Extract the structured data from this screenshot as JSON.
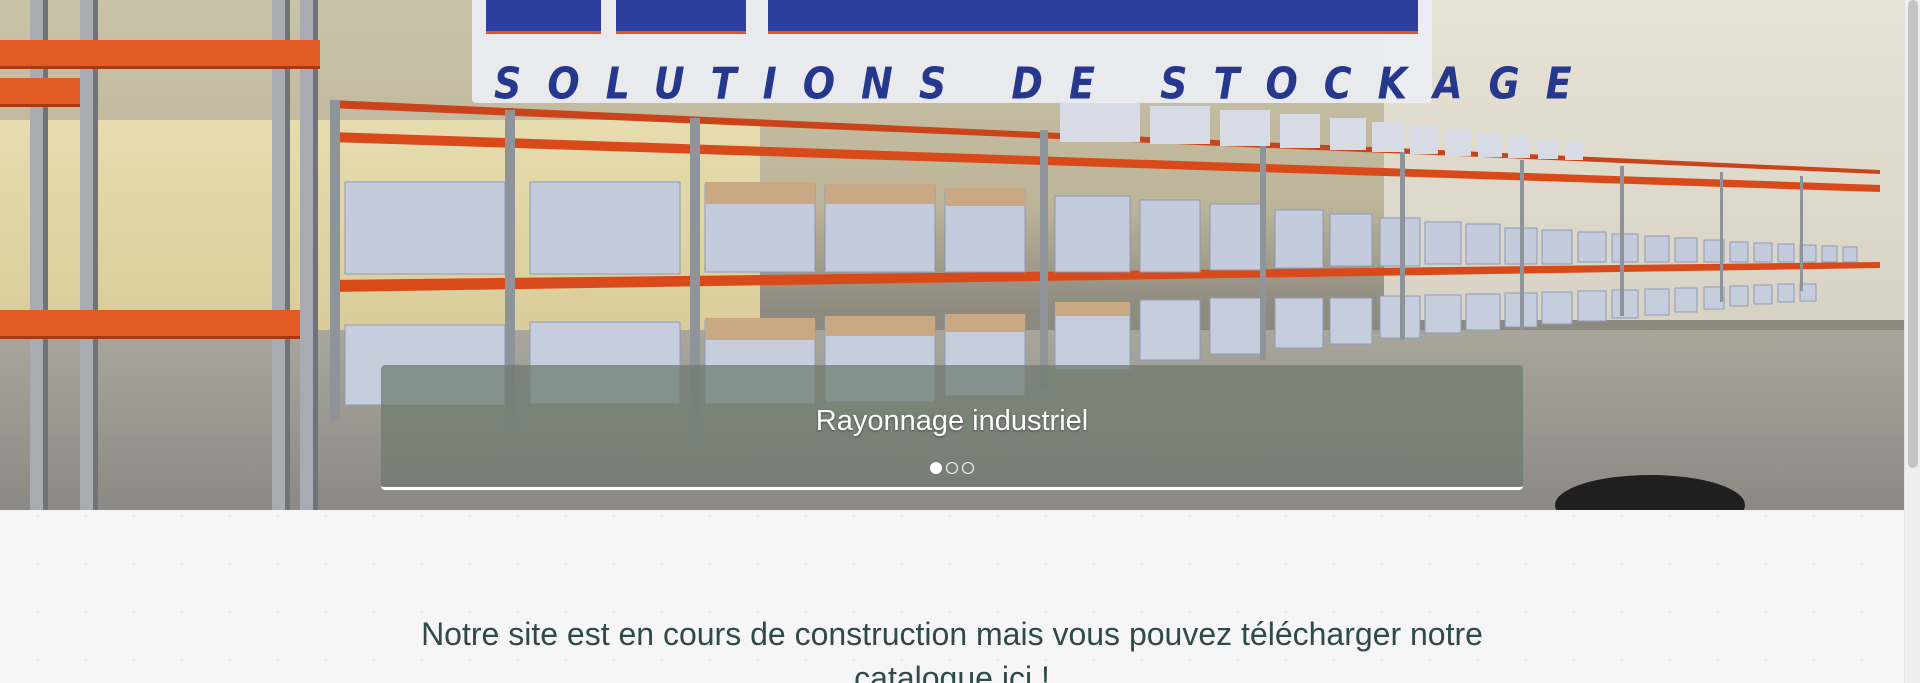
{
  "logo": {
    "tagline": "SOLUTIONS DE STOCKAGE"
  },
  "slider": {
    "caption": "Rayonnage industriel",
    "slide_count": 3,
    "active_index": 0
  },
  "content": {
    "intro_text": "Notre site est en cours de construction mais vous pouvez télécharger notre catalogue ici !"
  },
  "colors": {
    "brand_blue": "#2d3e9e",
    "brand_orange": "#e0581f",
    "text_teal": "#2e4a4a"
  }
}
